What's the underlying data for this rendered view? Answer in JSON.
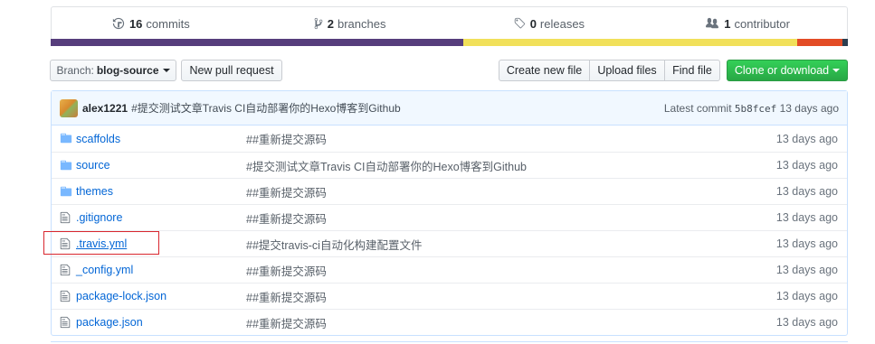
{
  "summary": {
    "commits": {
      "count": "16",
      "label": "commits",
      "icon": "history-icon"
    },
    "branches": {
      "count": "2",
      "label": "branches",
      "icon": "git-branch-icon"
    },
    "releases": {
      "count": "0",
      "label": "releases",
      "icon": "tag-icon"
    },
    "contributors": {
      "count": "1",
      "label": "contributor",
      "icon": "people-icon"
    }
  },
  "languages": [
    {
      "color": "#563d7c",
      "share": 0.518
    },
    {
      "color": "#f1e05a",
      "share": 0.419
    },
    {
      "color": "#e34c26",
      "share": 0.056
    },
    {
      "color": "#2b3e50",
      "share": 0.007
    }
  ],
  "toolbar": {
    "branch_label": "Branch:",
    "branch_name": "blog-source",
    "new_pull_request": "New pull request",
    "create_new_file": "Create new file",
    "upload_files": "Upload files",
    "find_file": "Find file",
    "clone_or_download": "Clone or download"
  },
  "latest_commit": {
    "author": "alex1221",
    "message": "#提交测试文章Travis CI自动部署你的Hexo博客到Github",
    "label": "Latest commit",
    "sha": "5b8fcef",
    "age": "13 days ago"
  },
  "files": [
    {
      "type": "dir",
      "icon": "folder-icon",
      "name": "scaffolds",
      "message": "##重新提交源码",
      "age": "13 days ago"
    },
    {
      "type": "dir",
      "icon": "folder-icon",
      "name": "source",
      "message": "#提交测试文章Travis CI自动部署你的Hexo博客到Github",
      "age": "13 days ago"
    },
    {
      "type": "dir",
      "icon": "folder-icon",
      "name": "themes",
      "message": "##重新提交源码",
      "age": "13 days ago"
    },
    {
      "type": "file",
      "icon": "file-icon",
      "name": ".gitignore",
      "message": "##重新提交源码",
      "age": "13 days ago"
    },
    {
      "type": "file",
      "icon": "file-icon",
      "name": ".travis.yml",
      "message": "##提交travis-ci自动化构建配置文件",
      "age": "13 days ago",
      "highlighted": true
    },
    {
      "type": "file",
      "icon": "file-icon",
      "name": "_config.yml",
      "message": "##重新提交源码",
      "age": "13 days ago"
    },
    {
      "type": "file",
      "icon": "file-icon",
      "name": "package-lock.json",
      "message": "##重新提交源码",
      "age": "13 days ago"
    },
    {
      "type": "file",
      "icon": "file-icon",
      "name": "package.json",
      "message": "##重新提交源码",
      "age": "13 days ago"
    }
  ]
}
